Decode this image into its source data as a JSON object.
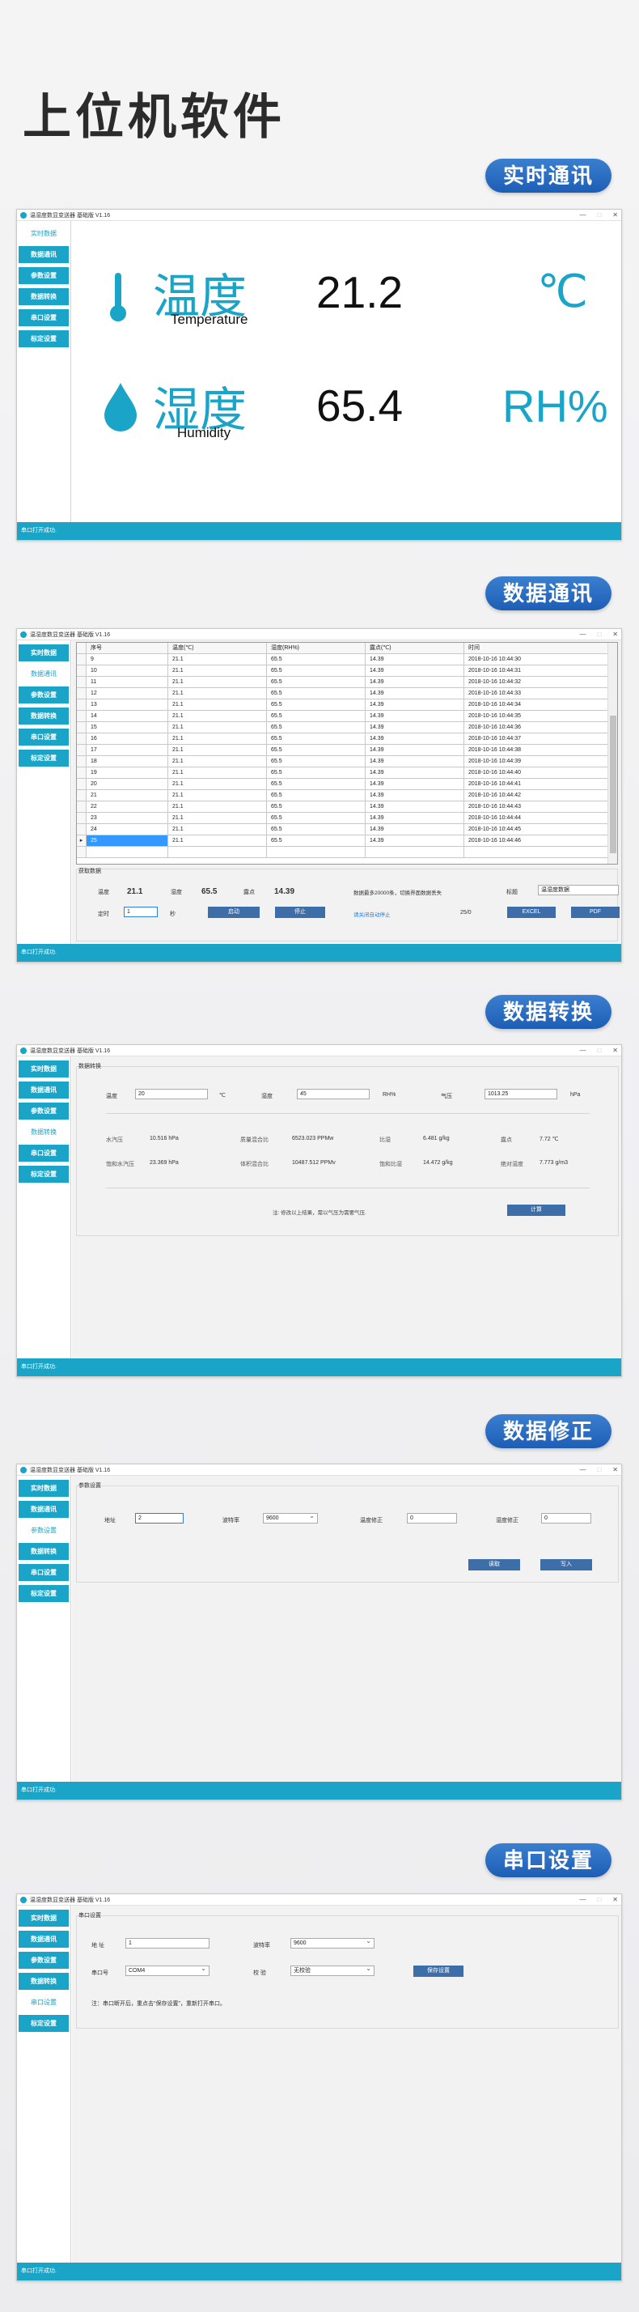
{
  "page_title": "上位机软件",
  "app_title": "温湿度数显变送器 基础版 V1.16",
  "status_text": "串口打开成功.",
  "nav": [
    "实时数据",
    "数据通讯",
    "参数设置",
    "数据转换",
    "串口设置",
    "标定设置"
  ],
  "sections": {
    "realtime": "实时通讯",
    "comm": "数据通讯",
    "convert": "数据转换",
    "correct": "数据修正",
    "serial": "串口设置"
  },
  "realtime": {
    "temp_label": "温度",
    "temp_sub": "Temperature",
    "temp_value": "21.2",
    "temp_unit": "℃",
    "hum_label": "湿度",
    "hum_sub": "Humidity",
    "hum_value": "65.4",
    "hum_unit": "RH%"
  },
  "comm": {
    "columns": [
      "序号",
      "温度(℃)",
      "湿度(RH%)",
      "露点(℃)",
      "时间"
    ],
    "rows": [
      [
        "9",
        "21.1",
        "65.5",
        "14.39",
        "2018-10-16 10:44:30"
      ],
      [
        "10",
        "21.1",
        "65.5",
        "14.39",
        "2018-10-16 10:44:31"
      ],
      [
        "11",
        "21.1",
        "65.5",
        "14.39",
        "2018-10-16 10:44:32"
      ],
      [
        "12",
        "21.1",
        "65.5",
        "14.39",
        "2018-10-16 10:44:33"
      ],
      [
        "13",
        "21.1",
        "65.5",
        "14.39",
        "2018-10-16 10:44:34"
      ],
      [
        "14",
        "21.1",
        "65.5",
        "14.39",
        "2018-10-16 10:44:35"
      ],
      [
        "15",
        "21.1",
        "65.5",
        "14.39",
        "2018-10-16 10:44:36"
      ],
      [
        "16",
        "21.1",
        "65.5",
        "14.39",
        "2018-10-16 10:44:37"
      ],
      [
        "17",
        "21.1",
        "65.5",
        "14.39",
        "2018-10-16 10:44:38"
      ],
      [
        "18",
        "21.1",
        "65.5",
        "14.39",
        "2018-10-16 10:44:39"
      ],
      [
        "19",
        "21.1",
        "65.5",
        "14.39",
        "2018-10-16 10:44:40"
      ],
      [
        "20",
        "21.1",
        "65.5",
        "14.39",
        "2018-10-16 10:44:41"
      ],
      [
        "21",
        "21.1",
        "65.5",
        "14.39",
        "2018-10-16 10:44:42"
      ],
      [
        "22",
        "21.1",
        "65.5",
        "14.39",
        "2018-10-16 10:44:43"
      ],
      [
        "23",
        "21.1",
        "65.5",
        "14.39",
        "2018-10-16 10:44:44"
      ],
      [
        "24",
        "21.1",
        "65.5",
        "14.39",
        "2018-10-16 10:44:45"
      ],
      [
        "25",
        "21.1",
        "65.5",
        "14.39",
        "2018-10-16 10:44:46"
      ]
    ],
    "group_title": "获取数据",
    "temp_label": "温度",
    "temp_value": "21.1",
    "hum_label": "湿度",
    "hum_value": "65.5",
    "dew_label": "露点",
    "dew_value": "14.39",
    "note": "数据最多20000条，切换界面数据丢失",
    "title_label": "标题",
    "title_value": "温湿度数据",
    "timer_label": "定时",
    "timer_value": "1",
    "timer_unit": "秒",
    "start_btn": "启动",
    "stop_btn": "停止",
    "hint": "请关闭自动停止",
    "count": "25/0",
    "excel_btn": "EXCEL",
    "pdf_btn": "PDF"
  },
  "convert": {
    "group_title": "数据转换",
    "temp_label": "温度",
    "temp_value": "20",
    "temp_unit": "℃",
    "hum_label": "湿度",
    "hum_value": "45",
    "hum_unit": "RH%",
    "press_label": "气压",
    "press_value": "1013.25",
    "press_unit": "hPa",
    "r1": [
      [
        "水汽压",
        "10.516 hPa"
      ],
      [
        "质量混合比",
        "6523.023 PPMw"
      ],
      [
        "比湿",
        "6.481 g/kg"
      ],
      [
        "露点",
        "7.72 ℃"
      ]
    ],
    "r2": [
      [
        "饱和水汽压",
        "23.369 hPa"
      ],
      [
        "体积混合比",
        "10487.512 PPMv"
      ],
      [
        "饱和比湿",
        "14.472 g/kg"
      ],
      [
        "绝对湿度",
        "7.773 g/m3"
      ]
    ],
    "note": "注: 修改以上结果，需以气压为需要气压.",
    "calc_btn": "计算"
  },
  "correct": {
    "group_title": "参数设置",
    "addr_label": "地址",
    "addr_value": "2",
    "baud_label": "波特率",
    "baud_value": "9600",
    "tfix_label": "温度修正",
    "tfix_value": "0",
    "hfix_label": "湿度修正",
    "hfix_value": "0",
    "read_btn": "读取",
    "write_btn": "写入"
  },
  "serial": {
    "group_title": "串口设置",
    "addr_label": "地 址",
    "addr_value": "1",
    "baud_label": "波特率",
    "baud_value": "9600",
    "port_label": "串口号",
    "port_value": "COM4",
    "parity_label": "校 验",
    "parity_value": "无校验",
    "save_btn": "保存设置",
    "note": "注：串口断开后，重点击\"保存设置\"，重新打开串口。"
  }
}
